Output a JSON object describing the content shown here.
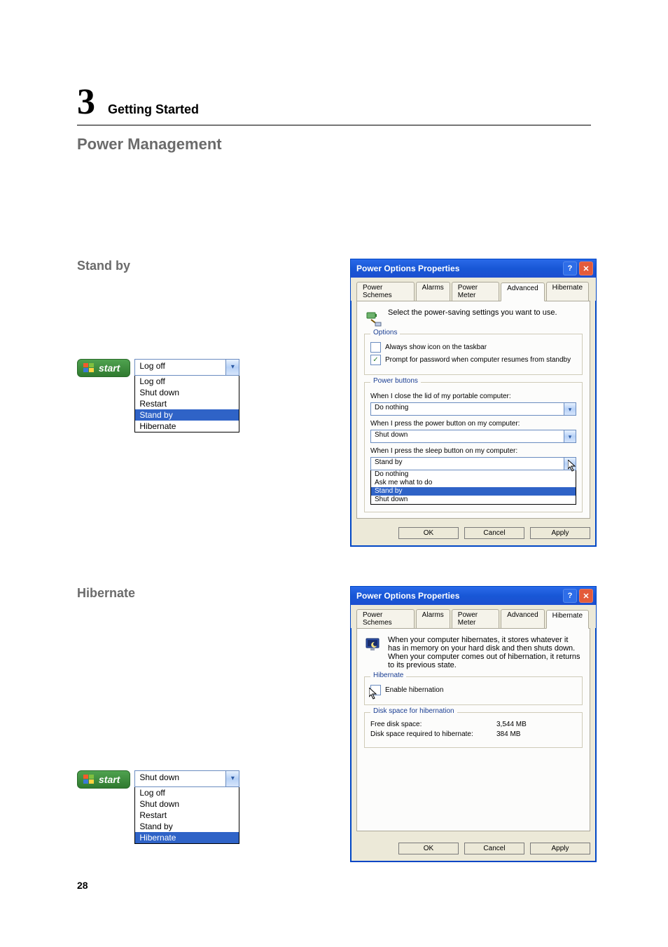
{
  "chapter": {
    "number": "3",
    "title": "Getting Started"
  },
  "section": "Power Management",
  "sub_standby": "Stand by",
  "sub_hibernate": "Hibernate",
  "page_number": "28",
  "start_button": "start",
  "standby_dropdown": {
    "selected": "Log off",
    "items": [
      "Log off",
      "Shut down",
      "Restart",
      "Stand by",
      "Hibernate"
    ],
    "highlight_index": 3
  },
  "hibernate_dropdown": {
    "selected": "Shut down",
    "items": [
      "Log off",
      "Shut down",
      "Restart",
      "Stand by",
      "Hibernate"
    ],
    "highlight_index": 4
  },
  "dialog_common": {
    "title": "Power Options Properties",
    "tabs": [
      "Power Schemes",
      "Alarms",
      "Power Meter",
      "Advanced",
      "Hibernate"
    ],
    "ok": "OK",
    "cancel": "Cancel",
    "apply": "Apply"
  },
  "advanced": {
    "intro": "Select the power-saving settings you want to use.",
    "options_legend": "Options",
    "cb_showicon": "Always show icon on the taskbar",
    "cb_prompt": "Prompt for password when computer resumes from standby",
    "pb_legend": "Power buttons",
    "lid_label": "When I close the lid of my portable computer:",
    "lid_value": "Do nothing",
    "power_label": "When I press the power button on my computer:",
    "power_value": "Shut down",
    "sleep_label": "When I press the sleep button on my computer:",
    "sleep_value": "Stand by",
    "sleep_options": [
      "Do nothing",
      "Ask me what to do",
      "Stand by",
      "Shut down"
    ],
    "sleep_highlight_index": 2
  },
  "hibernate_tab": {
    "intro": "When your computer hibernates, it stores whatever it has in memory on your hard disk and then shuts down. When your computer comes out of hibernation, it returns to its previous state.",
    "hib_legend": "Hibernate",
    "enable_label": "Enable hibernation",
    "disk_legend": "Disk space for hibernation",
    "free_label": "Free disk space:",
    "free_value": "3,544 MB",
    "req_label": "Disk space required to hibernate:",
    "req_value": "384 MB"
  }
}
